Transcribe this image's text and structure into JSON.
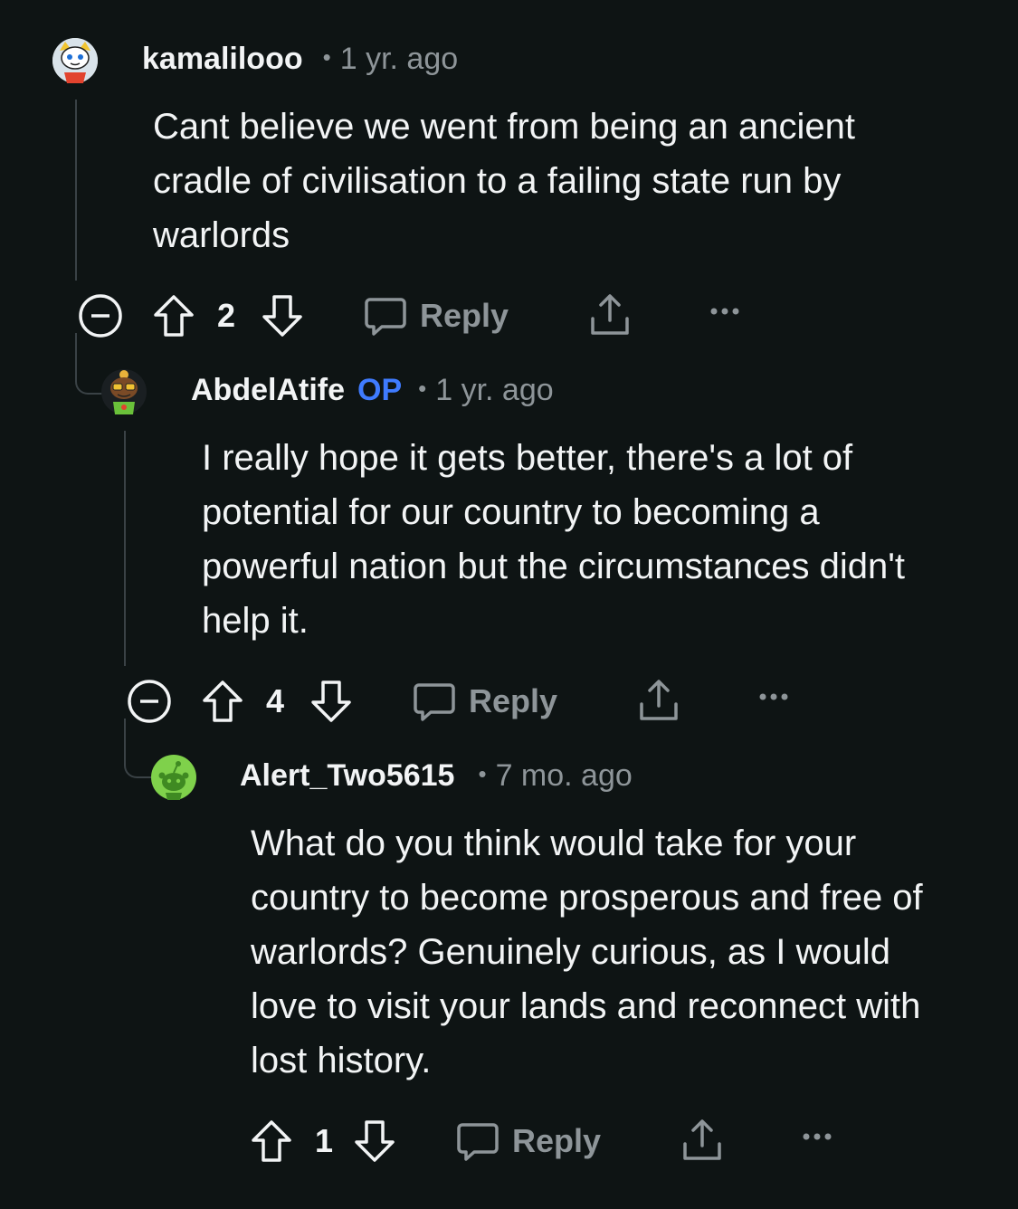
{
  "comments": [
    {
      "username": "kamalilooo",
      "op_badge": "",
      "time": "1 yr. ago",
      "body": "Cant believe we went from being an ancient cradle of civilisation to a failing state run by warlords",
      "score": "2",
      "reply_label": "Reply",
      "avatar_icon": "snoo-avatar-icon"
    },
    {
      "username": "AbdelAtife",
      "op_badge": "OP",
      "time": "1 yr. ago",
      "body": "I really hope it gets better, there's a lot of potential for our country to becoming a powerful nation but the circumstances didn't help it.",
      "score": "4",
      "reply_label": "Reply",
      "avatar_icon": "snoo-avatar-icon"
    },
    {
      "username": "Alert_Two5615",
      "op_badge": "",
      "time": "7 mo. ago",
      "body": "What do you think would take for your country to become prosperous and free of warlords? Genuinely curious, as I would love to visit your lands and reconnect with lost history.",
      "score": "1",
      "reply_label": "Reply",
      "avatar_icon": "default-snoo-avatar-icon"
    }
  ],
  "colors": {
    "background": "#0e1414",
    "text": "#f2f4f5",
    "muted": "#8e9599",
    "op_blue": "#3f7bff",
    "thread_line": "#3a4246"
  }
}
